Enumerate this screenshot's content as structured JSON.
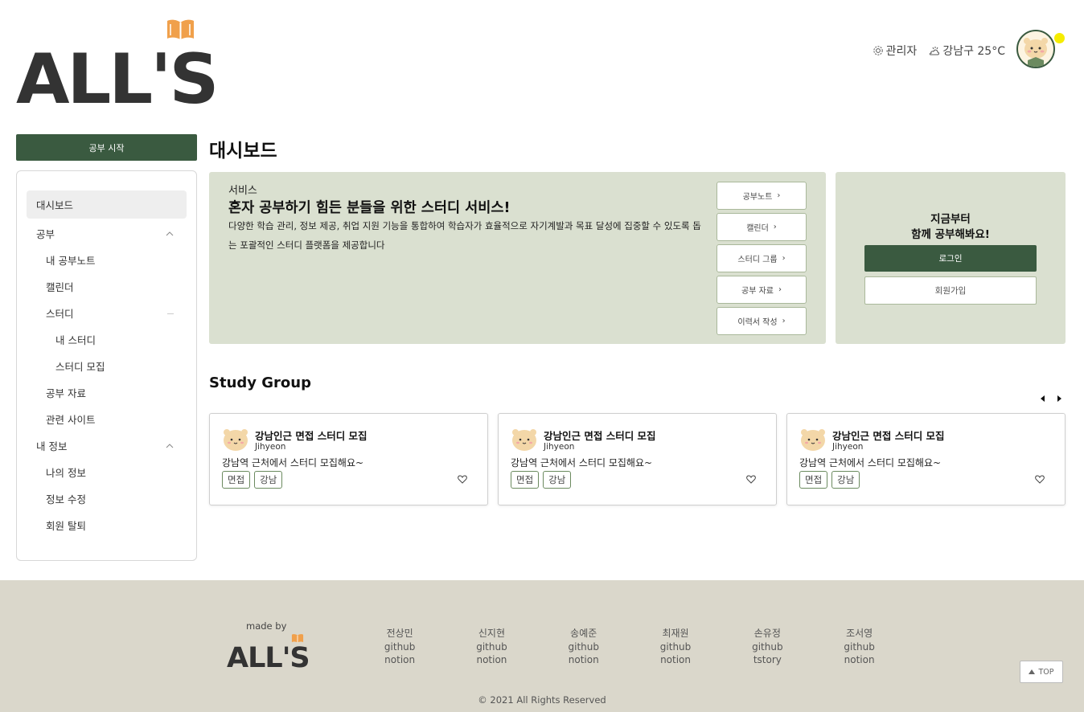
{
  "header": {
    "logo_text": "ALL'S",
    "admin_label": "관리자",
    "weather_label": "강남구 25°C"
  },
  "sidebar": {
    "start_button": "공부 시작",
    "items": [
      {
        "label": "대시보드"
      },
      {
        "label": "공부"
      },
      {
        "label": "내 공부노트"
      },
      {
        "label": "캘린더"
      },
      {
        "label": "스터디"
      },
      {
        "label": "내 스터디"
      },
      {
        "label": "스터디 모집"
      },
      {
        "label": "공부 자료"
      },
      {
        "label": "관련 사이트"
      },
      {
        "label": "내 정보"
      },
      {
        "label": "나의 정보"
      },
      {
        "label": "정보 수정"
      },
      {
        "label": "회원 탈퇴"
      }
    ]
  },
  "main": {
    "title": "대시보드",
    "service": {
      "label": "서비스",
      "heading": "혼자 공부하기 힘든 분들을 위한 스터디 서비스!",
      "description": "다양한 학습 관리, 정보 제공, 취업 지원 기능을 통합하여 학습자가 효율적으로 자기계발과 목표 달성에 집중할 수 있도록 돕는 포괄적인 스터디 플랫폼을 제공합니다",
      "buttons": [
        "공부노트",
        "캘린더",
        "스터디 그룹",
        "공부 자료",
        "이력서 작성"
      ]
    },
    "login": {
      "title_line1": "지금부터",
      "title_line2": "함께 공부해봐요!",
      "login_button": "로그인",
      "signup_button": "회원가입"
    },
    "study_group": {
      "title": "Study Group",
      "cards": [
        {
          "title": "강남인근 면접 스터디 모집",
          "author": "Jihyeon",
          "description": "강남역 근처에서 스터디 모집해요~",
          "tags": [
            "면접",
            "강남"
          ]
        },
        {
          "title": "강남인근 면접 스터디 모집",
          "author": "Jihyeon",
          "description": "강남역 근처에서 스터디 모집해요~",
          "tags": [
            "면접",
            "강남"
          ]
        },
        {
          "title": "강남인근 면접 스터디 모집",
          "author": "Jihyeon",
          "description": "강남역 근처에서 스터디 모집해요~",
          "tags": [
            "면접",
            "강남"
          ]
        }
      ]
    }
  },
  "footer": {
    "made_by": "made by",
    "logo_text": "ALL'S",
    "members": [
      {
        "name": "전상민",
        "link1": "github",
        "link2": "notion"
      },
      {
        "name": "신지현",
        "link1": "github",
        "link2": "notion"
      },
      {
        "name": "송예준",
        "link1": "github",
        "link2": "notion"
      },
      {
        "name": "최재원",
        "link1": "github",
        "link2": "notion"
      },
      {
        "name": "손유정",
        "link1": "github",
        "link2": "tstory"
      },
      {
        "name": "조서영",
        "link1": "github",
        "link2": "notion"
      }
    ],
    "top_button": "TOP",
    "copyright": "© 2021 All Rights Reserved"
  },
  "colors": {
    "brand_green": "#3a5a40",
    "panel_green": "#dae0d0",
    "footer_bg": "#dad7cb",
    "logo_orange": "#f0a04b",
    "notify_yellow": "#f5ec00"
  }
}
